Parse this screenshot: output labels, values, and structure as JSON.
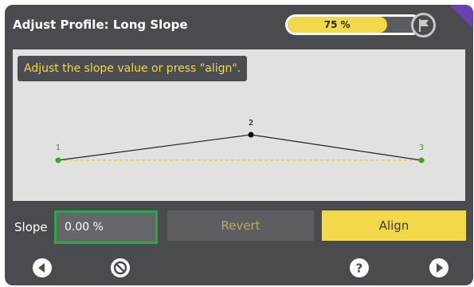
{
  "header": {
    "title": "Adjust Profile: Long Slope",
    "progress_value": 0.75,
    "progress_label": "75 %"
  },
  "canvas": {
    "hint": "Adjust the slope value or press \"align\".",
    "points": [
      {
        "label": "1",
        "color": "#37a61f"
      },
      {
        "label": "2",
        "color": "#000000"
      },
      {
        "label": "3",
        "color": "#37a61f"
      }
    ],
    "line_color": "#222222",
    "reference_line_color": "#e8c83a"
  },
  "controls": {
    "slope_label": "Slope",
    "slope_value": "0.00 %",
    "revert_label": "Revert",
    "align_label": "Align"
  },
  "icons": {
    "back": "arrow-left-circle-icon",
    "cancel": "cancel-circle-icon",
    "help": "help-circle-icon",
    "next": "arrow-right-circle-icon",
    "flag": "flag-icon"
  },
  "colors": {
    "accent": "#f2d84a",
    "focus": "#29a848",
    "panel": "#4a4b4f"
  }
}
